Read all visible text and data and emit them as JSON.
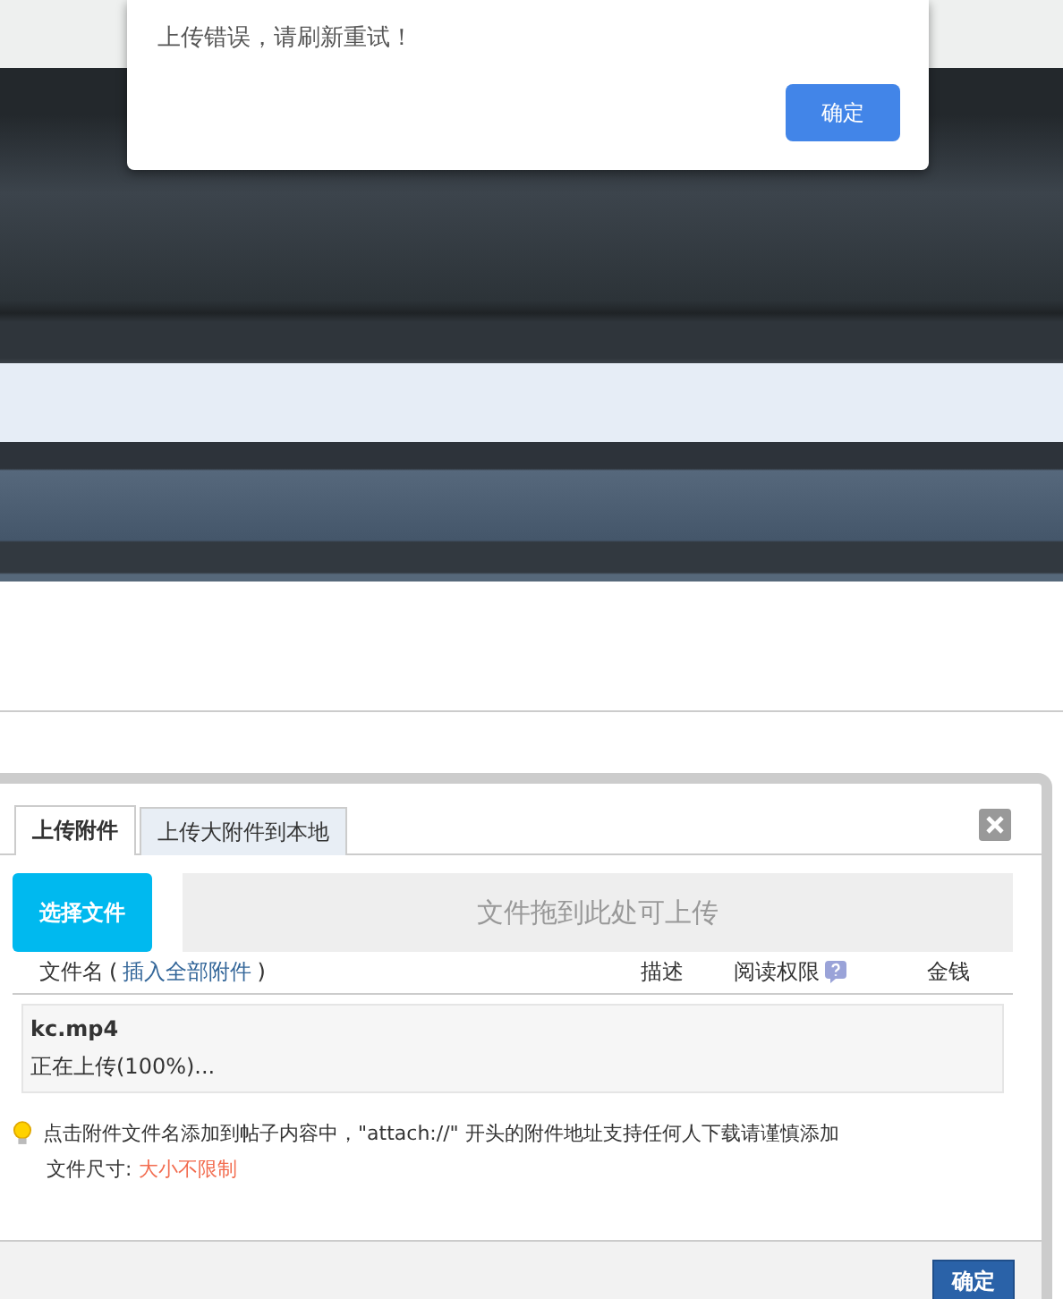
{
  "alert": {
    "message": "上传错误，请刷新重试！",
    "button": "确定"
  },
  "upload_dialog": {
    "tabs": [
      {
        "label": "上传附件",
        "selected": true
      },
      {
        "label": "上传大附件到本地",
        "selected": false
      }
    ],
    "select_button": "选择文件",
    "drop_zone": "文件拖到此处可上传",
    "columns": {
      "filename": "文件名",
      "insert_all_open": "(",
      "insert_all": "插入全部附件",
      "insert_all_close": ")",
      "description": "描述",
      "read_permission": "阅读权限",
      "money": "金钱"
    },
    "files": [
      {
        "name": "kc.mp4",
        "status": "正在上传(100%)..."
      }
    ],
    "tip": "点击附件文件名添加到帖子内容中，\"attach://\" 开头的附件地址支持任何人下载请谨慎添加",
    "size_label": "文件尺寸:",
    "size_value": "大小不限制",
    "confirm_button": "确定"
  }
}
